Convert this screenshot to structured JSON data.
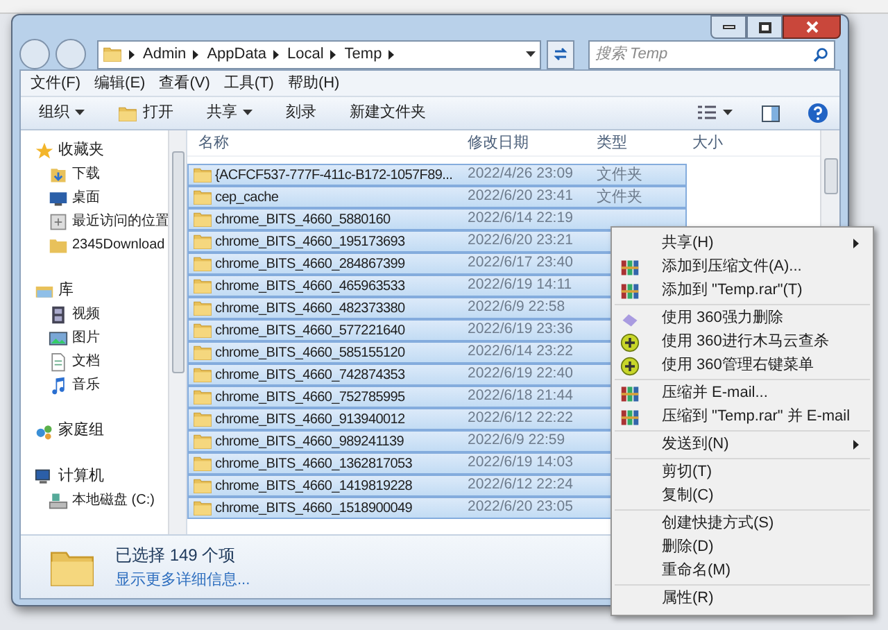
{
  "address": {
    "crumbs": [
      "Admin",
      "AppData",
      "Local",
      "Temp"
    ]
  },
  "search": {
    "placeholder": "搜索 Temp"
  },
  "menubar": [
    "文件(F)",
    "编辑(E)",
    "查看(V)",
    "工具(T)",
    "帮助(H)"
  ],
  "toolbar": [
    {
      "label": "组织",
      "kind": "dropdown"
    },
    {
      "label": "打开",
      "kind": "open"
    },
    {
      "label": "共享",
      "kind": "dropdown"
    },
    {
      "label": "刻录",
      "kind": "plain"
    },
    {
      "label": "新建文件夹",
      "kind": "plain"
    }
  ],
  "sidebar": {
    "items": [
      {
        "label": "收藏夹",
        "kind": "star",
        "children": [
          {
            "label": "下载",
            "kind": "download"
          },
          {
            "label": "桌面",
            "kind": "desktop"
          },
          {
            "label": "最近访问的位置",
            "kind": "recent"
          },
          {
            "label": "2345Download",
            "kind": "folder"
          }
        ]
      },
      {
        "label": "库",
        "kind": "library",
        "children": [
          {
            "label": "视频",
            "kind": "video"
          },
          {
            "label": "图片",
            "kind": "picture"
          },
          {
            "label": "文档",
            "kind": "document"
          },
          {
            "label": "音乐",
            "kind": "music"
          }
        ]
      },
      {
        "label": "家庭组",
        "kind": "homegroup"
      },
      {
        "label": "计算机",
        "kind": "computer",
        "children": [
          {
            "label": "本地磁盘 (C:)",
            "kind": "drive"
          }
        ]
      }
    ]
  },
  "table": {
    "columns": [
      "名称",
      "修改日期",
      "类型",
      "大小"
    ],
    "rows": [
      {
        "name": "{ACFCF537-777F-411c-B172-1057F89...",
        "date": "2022/4/26 23:09",
        "type": "文件夹",
        "selected": true
      },
      {
        "name": "cep_cache",
        "date": "2022/6/20 23:41",
        "type": "文件夹",
        "selected": true
      },
      {
        "name": "chrome_BITS_4660_5880160",
        "date": "2022/6/14 22:19",
        "selected": true
      },
      {
        "name": "chrome_BITS_4660_195173693",
        "date": "2022/6/20 23:21",
        "selected": true
      },
      {
        "name": "chrome_BITS_4660_284867399",
        "date": "2022/6/17 23:40",
        "selected": true
      },
      {
        "name": "chrome_BITS_4660_465963533",
        "date": "2022/6/19 14:11",
        "selected": true
      },
      {
        "name": "chrome_BITS_4660_482373380",
        "date": "2022/6/9 22:58",
        "selected": true
      },
      {
        "name": "chrome_BITS_4660_577221640",
        "date": "2022/6/19 23:36",
        "selected": true
      },
      {
        "name": "chrome_BITS_4660_585155120",
        "date": "2022/6/14 23:22",
        "selected": true
      },
      {
        "name": "chrome_BITS_4660_742874353",
        "date": "2022/6/19 22:40",
        "selected": true
      },
      {
        "name": "chrome_BITS_4660_752785995",
        "date": "2022/6/18 21:44",
        "selected": true
      },
      {
        "name": "chrome_BITS_4660_913940012",
        "date": "2022/6/12 22:22",
        "selected": true
      },
      {
        "name": "chrome_BITS_4660_989241139",
        "date": "2022/6/9 22:59",
        "selected": true
      },
      {
        "name": "chrome_BITS_4660_1362817053",
        "date": "2022/6/19 14:03",
        "selected": true
      },
      {
        "name": "chrome_BITS_4660_1419819228",
        "date": "2022/6/12 22:24",
        "selected": true
      },
      {
        "name": "chrome_BITS_4660_1518900049",
        "date": "2022/6/20 23:05",
        "selected": true
      }
    ]
  },
  "details": {
    "summary": "已选择 149 个项",
    "link": "显示更多详细信息..."
  },
  "context_menu": {
    "groups": [
      [
        {
          "label": "共享(H)",
          "kind": "plain",
          "submenu": true
        },
        {
          "label": "添加到压缩文件(A)...",
          "kind": "archive",
          "submenu": false
        },
        {
          "label": "添加到 \"Temp.rar\"(T)",
          "kind": "archive",
          "submenu": false
        }
      ],
      [
        {
          "label": "使用 360强力删除",
          "kind": "eraser",
          "submenu": false
        },
        {
          "label": "使用 360进行木马云查杀",
          "kind": "shield",
          "submenu": false
        },
        {
          "label": "使用 360管理右键菜单",
          "kind": "shield",
          "submenu": false
        }
      ],
      [
        {
          "label": "压缩并 E-mail...",
          "kind": "archive",
          "submenu": false
        },
        {
          "label": "压缩到 \"Temp.rar\" 并 E-mail",
          "kind": "archive",
          "submenu": false
        }
      ],
      [
        {
          "label": "发送到(N)",
          "kind": "plain",
          "submenu": true
        }
      ],
      [
        {
          "label": "剪切(T)",
          "kind": "plain",
          "submenu": false
        },
        {
          "label": "复制(C)",
          "kind": "plain",
          "submenu": false
        }
      ],
      [
        {
          "label": "创建快捷方式(S)",
          "kind": "plain",
          "submenu": false
        },
        {
          "label": "删除(D)",
          "kind": "plain",
          "submenu": false
        },
        {
          "label": "重命名(M)",
          "kind": "plain",
          "submenu": false
        }
      ],
      [
        {
          "label": "属性(R)",
          "kind": "plain",
          "submenu": false
        }
      ]
    ]
  }
}
